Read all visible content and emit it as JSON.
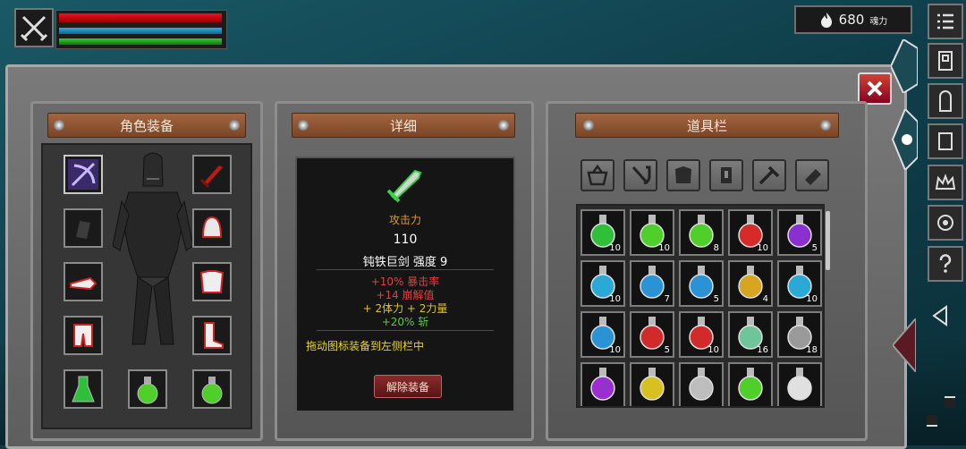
{
  "hud": {
    "souls_value": "680",
    "souls_unit": "魂力"
  },
  "panels": {
    "equipment_title": "角色装备",
    "detail_title": "详细",
    "inventory_title": "道具栏"
  },
  "detail": {
    "stat_label": "攻击力",
    "stat_value": "110",
    "item_name": "钝铁巨剑 强度 9",
    "bonus_1": "+10% 暴击率",
    "bonus_2": "+14 崩解值",
    "bonus_3": "+ 2体力  + 2力量",
    "bonus_4": "+20% 斩",
    "hint": "拖动图标装备到左侧栏中",
    "unequip_label": "解除装备"
  },
  "inventory": {
    "counts": [
      [
        "10",
        "10",
        "8",
        "10",
        "5"
      ],
      [
        "10",
        "7",
        "5",
        "4",
        "10"
      ],
      [
        "10",
        "5",
        "10",
        "16",
        "18"
      ],
      [
        "",
        "",
        "",
        "",
        ""
      ]
    ],
    "colors": [
      [
        "#2fbf3a",
        "#4fcf2a",
        "#4fcf2a",
        "#d92a2a",
        "#8a2fd0"
      ],
      [
        "#2aa9d6",
        "#2a93d6",
        "#2a93d6",
        "#d8a520",
        "#2aa9d6"
      ],
      [
        "#2a93d6",
        "#d02a2a",
        "#d02a2a",
        "#6fc59a",
        "#9a9a9a"
      ],
      [
        "#9a2fd0",
        "#d8c020",
        "#bdbdbd",
        "#4fcf2a",
        "#e0e0e0"
      ]
    ]
  },
  "colors": {
    "hp": "#dd1122",
    "mp": "#33aadd",
    "stamina": "#33cc33",
    "bonus_red": "#e04040",
    "bonus_yellow": "#e0c030",
    "bonus_green": "#55cc33"
  }
}
